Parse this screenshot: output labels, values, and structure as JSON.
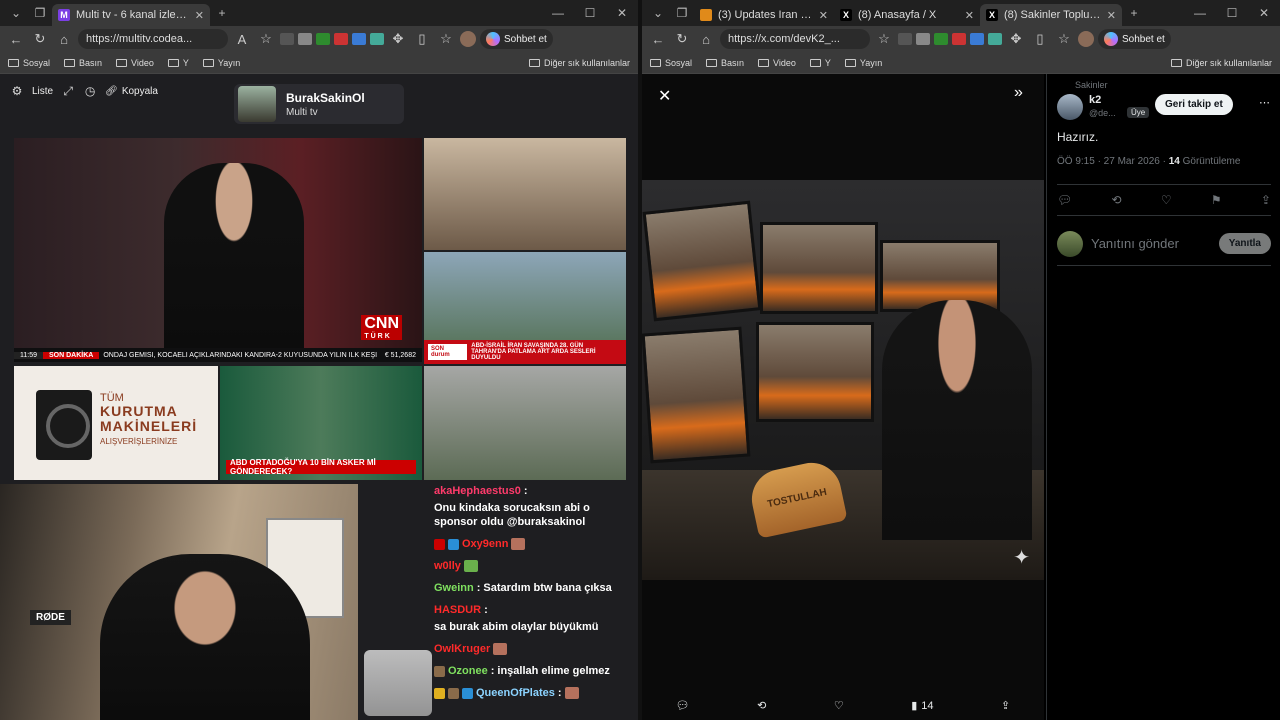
{
  "left": {
    "tabs": [
      {
        "title": "Multi tv - 6 kanal izleniyor",
        "active": true
      }
    ],
    "url": "https://multitv.codea...",
    "chat_button": "Sohbet et",
    "bookmarks": [
      "Sosyal",
      "Basın",
      "Video",
      "Y",
      "Yayın"
    ],
    "bookmarks_other": "Diğer sık kullanılanlar",
    "toolbar": {
      "list": "Liste",
      "copy": "Kopyala"
    },
    "channel": {
      "name": "BurakSakinOl",
      "sub": "Multi tv"
    },
    "cnn": {
      "time": "11:59",
      "breaking": "SON DAKİKA",
      "ticker": "ONDAJ GEMİSİ, KOCAELİ AÇIKLARINDAKİ KANDIRA-2 KUYUSUNDA YILIN İLK KEŞİ",
      "index": "€ 51,2682",
      "logo": "CNN",
      "logo_sub": "TÜRK"
    },
    "sondurum": {
      "label": "SON durum",
      "line1": "ABD-İSRAİL İRAN SAVAŞINDA 28. GÜN",
      "line2": "TAHRAN'DA PATLAMA ART ARDA SESLERİ DUYULDU"
    },
    "ad": {
      "line1": "TÜM",
      "line2": "KURUTMA",
      "line3": "MAKİNELERİ",
      "line4": "ALIŞVERİŞLERİNİZE"
    },
    "houthi_caption": "ABD ORTADOĞU'YA 10 BİN ASKER Mİ GÖNDERECEK?",
    "cam": {
      "mic_brand": "RØDE"
    },
    "chat": [
      {
        "user": "akaHephaestus0",
        "color": "#ff3b6b",
        "text": "Onu kindaka sorucaksın abi o sponsor oldu @buraksakinol"
      },
      {
        "user": "Oxy9enn",
        "color": "#ff2a2a",
        "text": ""
      },
      {
        "user": "w0lly",
        "color": "#ff2a2a",
        "text": ""
      },
      {
        "user": "Gweinn",
        "color": "#7fe05f",
        "text": "Satardım btw bana çıksa"
      },
      {
        "user": "HASDUR",
        "color": "#ff2a2a",
        "text": "sa burak abim olaylar büyükmü"
      },
      {
        "user": "OwlKruger",
        "color": "#ff2a2a",
        "text": ""
      },
      {
        "user": "Ozonee",
        "color": "#7fe05f",
        "text": "inşallah elime gelmez"
      },
      {
        "user": "QueenOfPlates",
        "color": "#8bd3ff",
        "text": ""
      }
    ]
  },
  "right": {
    "tabs": [
      {
        "title": "(3) Updates Iran war live: Trump",
        "active": false
      },
      {
        "title": "(8) Anasayfa / X",
        "active": false
      },
      {
        "title": "(8) Sakinler Topluluk / X",
        "active": true
      }
    ],
    "url": "https://x.com/devK2_...",
    "chat_button": "Sohbet et",
    "bookmarks": [
      "Sosyal",
      "Basın",
      "Video",
      "Y",
      "Yayın"
    ],
    "bookmarks_other": "Diğer sık kullanılanlar",
    "media": {
      "toast_text": "TOSTULLAH",
      "views": "14"
    },
    "post": {
      "community": "Sakinler",
      "name": "k2",
      "handle": "@de...",
      "member_badge": "Üye",
      "follow_label": "Geri takip et",
      "text": "Hazırız.",
      "meta": "ÖÖ 9:15 · 27 Mar 2026 ·",
      "views_count": "14",
      "views_label": "Görüntüleme",
      "reply_placeholder": "Yanıtını gönder",
      "reply_button": "Yanıtla"
    }
  }
}
